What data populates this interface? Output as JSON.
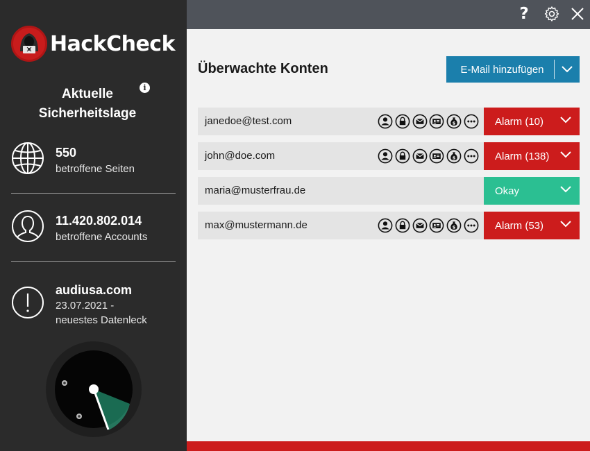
{
  "app": {
    "name": "HackCheck"
  },
  "sidebar": {
    "security_title": "Aktuelle Sicherheitslage",
    "info_icon": "info-icon",
    "stats": [
      {
        "icon": "globe-icon",
        "value": "550",
        "label": "betroffene Seiten"
      },
      {
        "icon": "user-outline-icon",
        "value": "11.420.802.014",
        "label": "betroffene Accounts"
      },
      {
        "icon": "exclamation-circle-icon",
        "value": "audiusa.com",
        "label_line1": "23.07.2021 -",
        "label_line2": "neuestes Datenleck"
      }
    ]
  },
  "topbar": {
    "icons": [
      "help-icon",
      "settings-icon",
      "close-icon"
    ],
    "help_glyph": "?"
  },
  "main": {
    "title": "Überwachte Konten",
    "add_button_label": "E-Mail hinzufügen",
    "accounts": [
      {
        "email": "janedoe@test.com",
        "status": "Alarm (10)",
        "state": "alarm",
        "icons": [
          "person-icon",
          "lock-icon",
          "mail-icon",
          "id-card-icon",
          "money-bag-icon",
          "more-icon"
        ]
      },
      {
        "email": "john@doe.com",
        "status": "Alarm (138)",
        "state": "alarm",
        "icons": [
          "person-icon",
          "lock-icon",
          "mail-icon",
          "id-card-icon",
          "money-bag-icon",
          "more-icon"
        ]
      },
      {
        "email": "maria@musterfrau.de",
        "status": "Okay",
        "state": "okay",
        "icons": []
      },
      {
        "email": "max@mustermann.de",
        "status": "Alarm (53)",
        "state": "alarm",
        "icons": [
          "person-icon",
          "lock-icon",
          "mail-icon",
          "id-card-icon",
          "money-bag-icon",
          "more-icon"
        ]
      }
    ]
  },
  "colors": {
    "alarm": "#cc1c1c",
    "okay": "#2bbf92",
    "accent": "#1b7fac",
    "sidebar": "#2b2b2b"
  }
}
